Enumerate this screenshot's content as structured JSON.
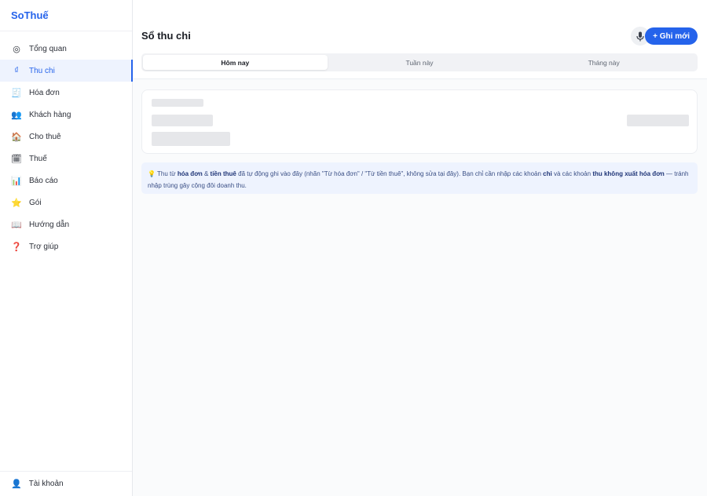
{
  "brand": "SoThuế",
  "sidebar": {
    "items": [
      {
        "label": "Tổng quan",
        "icon": "circle-gear-icon",
        "glyph": "◎",
        "active": false
      },
      {
        "label": "Thu chi",
        "icon": "dong-sign-icon",
        "glyph": "₫",
        "active": true
      },
      {
        "label": "Hóa đơn",
        "icon": "receipt-icon",
        "glyph": "🧾",
        "active": false
      },
      {
        "label": "Khách hàng",
        "icon": "people-icon",
        "glyph": "👥",
        "active": false
      },
      {
        "label": "Cho thuê",
        "icon": "house-icon",
        "glyph": "🏠",
        "active": false
      },
      {
        "label": "Thuế",
        "icon": "calendar-icon",
        "glyph": "🗓",
        "active": false
      },
      {
        "label": "Báo cáo",
        "icon": "bar-chart-icon",
        "glyph": "📊",
        "active": false
      },
      {
        "label": "Gói",
        "icon": "star-icon",
        "glyph": "⭐",
        "active": false
      },
      {
        "label": "Hướng dẫn",
        "icon": "book-icon",
        "glyph": "📖",
        "active": false
      },
      {
        "label": "Trợ giúp",
        "icon": "question-icon",
        "glyph": "❓",
        "active": false
      }
    ],
    "footer": {
      "label": "Tài khoản",
      "icon": "user-icon",
      "glyph": "👤"
    }
  },
  "header": {
    "title": "Sổ thu chi",
    "mic_icon": "microphone-icon",
    "add_label": "+ Ghi mới"
  },
  "tabs": [
    {
      "label": "Hôm nay",
      "active": true
    },
    {
      "label": "Tuần này",
      "active": false
    },
    {
      "label": "Tháng này",
      "active": false
    }
  ],
  "note": {
    "icon": "lightbulb-icon",
    "glyph": "💡",
    "t1": " Thu từ ",
    "b1": "hóa đơn",
    "t2": " & ",
    "b2": "tiền thuê",
    "t3": " đã tự động ghi vào đây (nhãn \"Từ hóa đơn\" / \"Từ tiền thuê\", không sửa tại đây). Bạn chỉ cần nhập các khoản ",
    "b3": "chi",
    "t4": " và các khoản ",
    "b4": "thu không xuất hóa đơn",
    "t5": " — tránh nhập trùng gây cộng đôi doanh thu."
  },
  "colors": {
    "accent": "#2563eb",
    "note_bg": "#eef3fe",
    "skeleton": "#e6e7ea"
  }
}
